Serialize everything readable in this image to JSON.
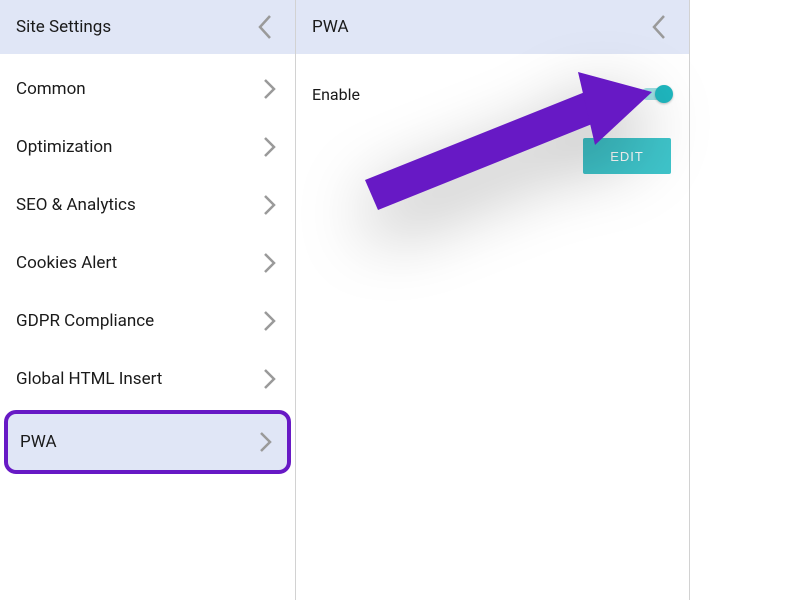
{
  "left_panel": {
    "title": "Site Settings",
    "items": [
      {
        "label": "Common"
      },
      {
        "label": "Optimization"
      },
      {
        "label": "SEO & Analytics"
      },
      {
        "label": "Cookies Alert"
      },
      {
        "label": "GDPR Compliance"
      },
      {
        "label": "Global HTML Insert"
      },
      {
        "label": "PWA",
        "active": true
      }
    ]
  },
  "right_panel": {
    "title": "PWA",
    "enable_label": "Enable",
    "enable_state": true,
    "edit_label": "EDIT"
  },
  "annotation": {
    "arrow_color": "#6719c5",
    "highlight_color": "#6719c5"
  }
}
